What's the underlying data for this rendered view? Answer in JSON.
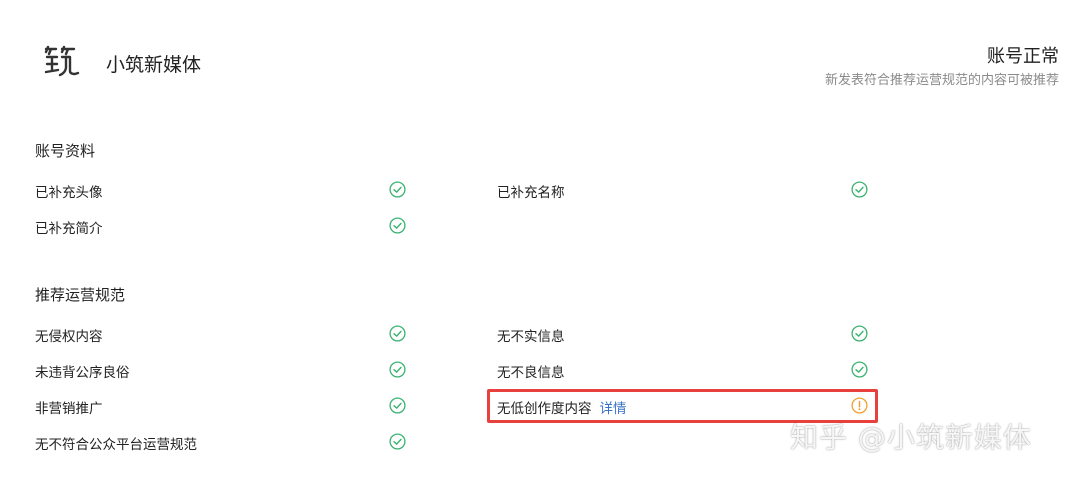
{
  "header": {
    "account_name": "小筑新媒体",
    "logo_icon": "zhu-logo-icon",
    "status_title": "账号正常",
    "status_desc": "新发表符合推荐运营规范的内容可被推荐"
  },
  "profile_section": {
    "title": "账号资料",
    "items": [
      {
        "label": "已补充头像",
        "status": "ok"
      },
      {
        "label": "已补充名称",
        "status": "ok"
      },
      {
        "label": "已补充简介",
        "status": "ok"
      }
    ]
  },
  "rules_section": {
    "title": "推荐运营规范",
    "items": [
      {
        "label": "无侵权内容",
        "status": "ok"
      },
      {
        "label": "无不实信息",
        "status": "ok"
      },
      {
        "label": "未违背公序良俗",
        "status": "ok"
      },
      {
        "label": "无不良信息",
        "status": "ok"
      },
      {
        "label": "非营销推广",
        "status": "ok"
      },
      {
        "label": "无低创作度内容",
        "status": "warning",
        "detail_link": "详情"
      },
      {
        "label": "无不符合公众平台运营规范",
        "status": "ok"
      }
    ]
  },
  "colors": {
    "ok": "#3cb371",
    "warning": "#f0a030",
    "highlight": "#e8403c",
    "link": "#3b73c9"
  },
  "watermark": "知乎 @小筑新媒体"
}
